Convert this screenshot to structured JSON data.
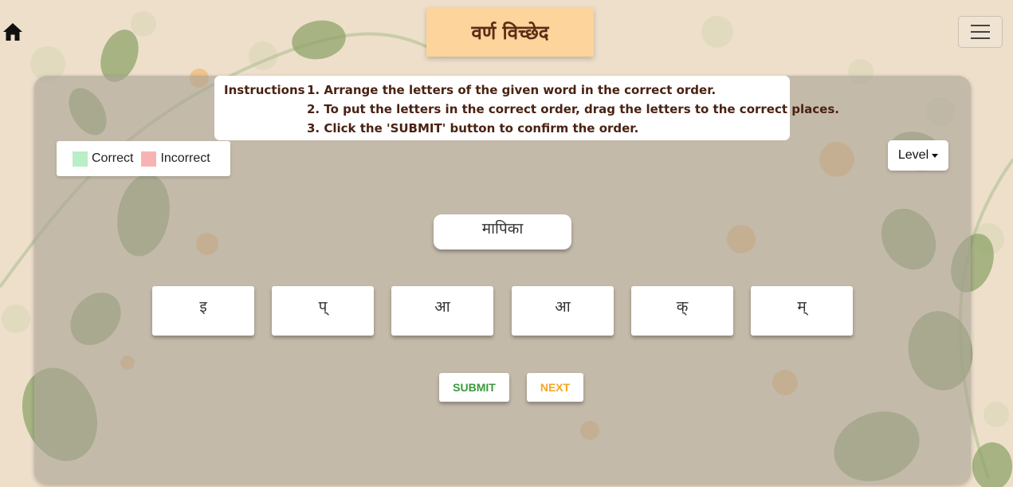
{
  "header": {
    "title": "वर्ण विच्छेद"
  },
  "instructions": {
    "label": "Instructions :",
    "steps": [
      "1. Arrange the letters of the given word in the correct order.",
      "2. To put the letters in the correct order, drag the letters to the correct places.",
      "3. Click the 'SUBMIT' button to confirm the order."
    ]
  },
  "legend": {
    "items": [
      {
        "label": "Correct",
        "color": "#b9eec6"
      },
      {
        "label": "Incorrect",
        "color": "#f7b3b3"
      }
    ]
  },
  "level_dropdown": {
    "label": "Level"
  },
  "word": "मापिका",
  "letter_tiles": [
    "इ",
    "प्",
    "आ",
    "आ",
    "क्",
    "म्"
  ],
  "buttons": {
    "submit": {
      "label": "SUBMIT",
      "color": "#3a9a3a"
    },
    "next": {
      "label": "NEXT",
      "color": "#f5a623"
    }
  },
  "colors": {
    "title_bg": "#fdd49b",
    "title_text": "#5b2d17",
    "page_bg": "#eedfcb"
  },
  "icons": {
    "home": "home-icon",
    "menu": "hamburger-menu-icon"
  }
}
